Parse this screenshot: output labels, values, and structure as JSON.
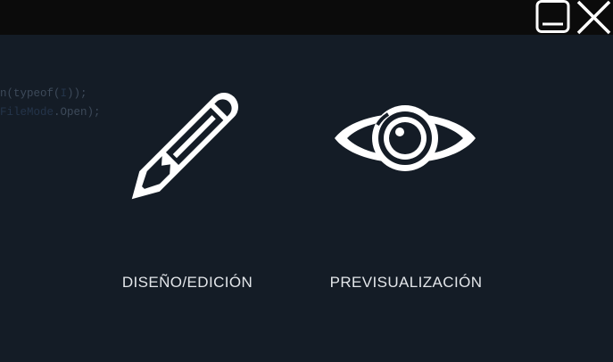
{
  "background_code": {
    "line1_visible": "n(typeof(",
    "line1_dim": "I",
    "line1_end": "));",
    "line2_dim": "FileMode",
    "line2_visible": ".Open);"
  },
  "options": [
    {
      "label": "DISEÑO/EDICIÓN",
      "icon": "pencil-icon"
    },
    {
      "label": "PREVISUALIZACIÓN",
      "icon": "eye-icon"
    }
  ],
  "titlebar": {
    "buttons": [
      "minimize-icon",
      "close-icon"
    ]
  },
  "colors": {
    "background": "#141c26",
    "titlebar": "#0b0b0b",
    "icon": "#ffffff",
    "label": "#e3e6ea"
  }
}
